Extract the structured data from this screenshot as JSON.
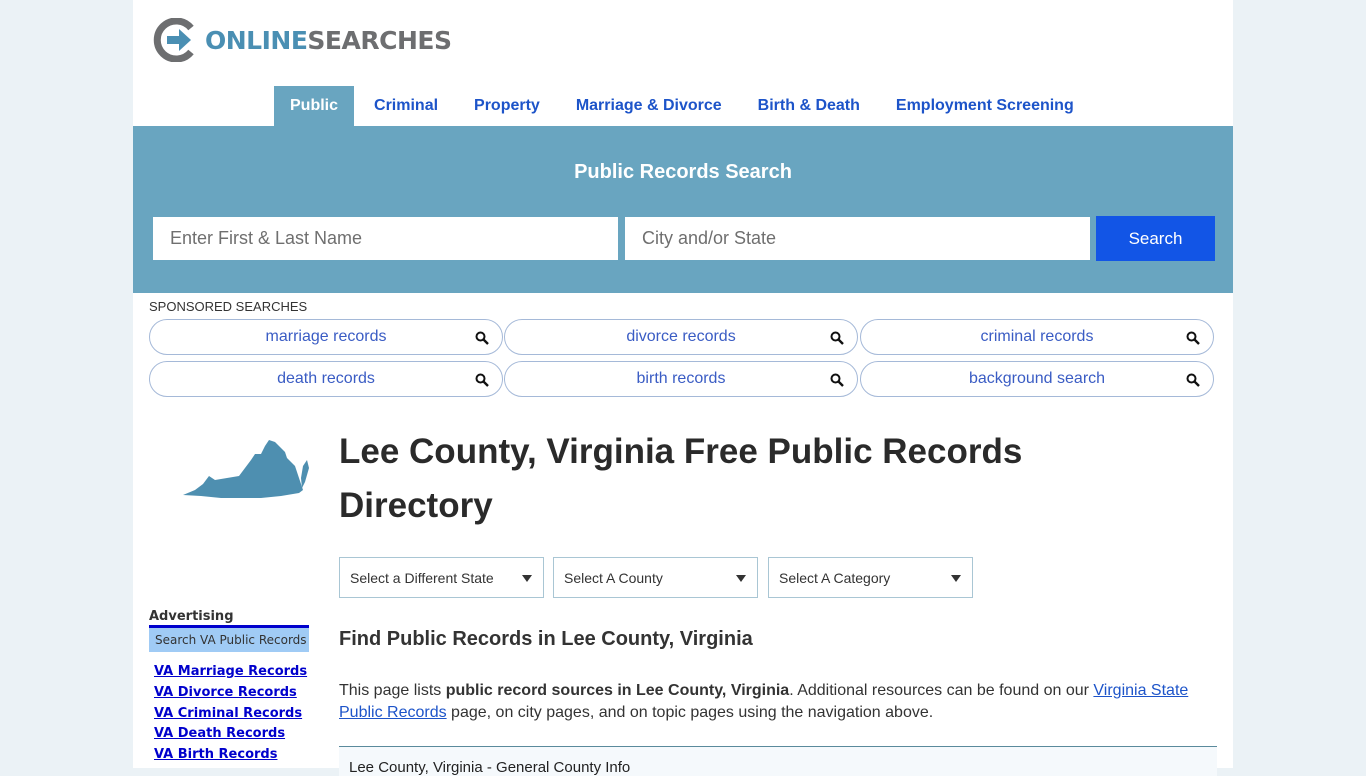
{
  "logo": {
    "part1": "ONLINE",
    "part2": "SEARCHES"
  },
  "nav": {
    "items": [
      {
        "label": "Public",
        "active": true
      },
      {
        "label": "Criminal",
        "active": false
      },
      {
        "label": "Property",
        "active": false
      },
      {
        "label": "Marriage & Divorce",
        "active": false
      },
      {
        "label": "Birth & Death",
        "active": false
      },
      {
        "label": "Employment Screening",
        "active": false
      }
    ]
  },
  "hero": {
    "title": "Public Records Search",
    "name_placeholder": "Enter First & Last Name",
    "name_value": "",
    "location_placeholder": "City and/or State",
    "location_value": "",
    "search_label": "Search"
  },
  "sponsored": {
    "label": "SPONSORED SEARCHES",
    "items": [
      "marriage records",
      "divorce records",
      "criminal records",
      "death records",
      "birth records",
      "background search"
    ]
  },
  "main": {
    "title": "Lee County, Virginia Free Public Records Directory",
    "selects": [
      "Select a Different State",
      "Select A County",
      "Select A Category"
    ],
    "subtitle": "Find Public Records in Lee County, Virginia",
    "intro": {
      "prefix": "This page lists ",
      "bold": "public record sources in Lee County, Virginia",
      "middle": ". Additional resources can be found on our ",
      "link": "Virginia State Public Records",
      "suffix": " page, on city pages, and on topic pages using the navigation above."
    },
    "info_header": "Lee County, Virginia - General County Info"
  },
  "sidebar": {
    "ad_label": "Advertising",
    "ad_box": "Search VA Public Records",
    "links": [
      "VA Marriage Records",
      "VA Divorce Records",
      "VA Criminal Records",
      "VA Death Records",
      "VA Birth Records"
    ]
  },
  "colors": {
    "brand_blue": "#69a5c0",
    "nav_link": "#1d54c9",
    "search_button": "#1255e6",
    "page_bg": "#ebf2f6"
  }
}
